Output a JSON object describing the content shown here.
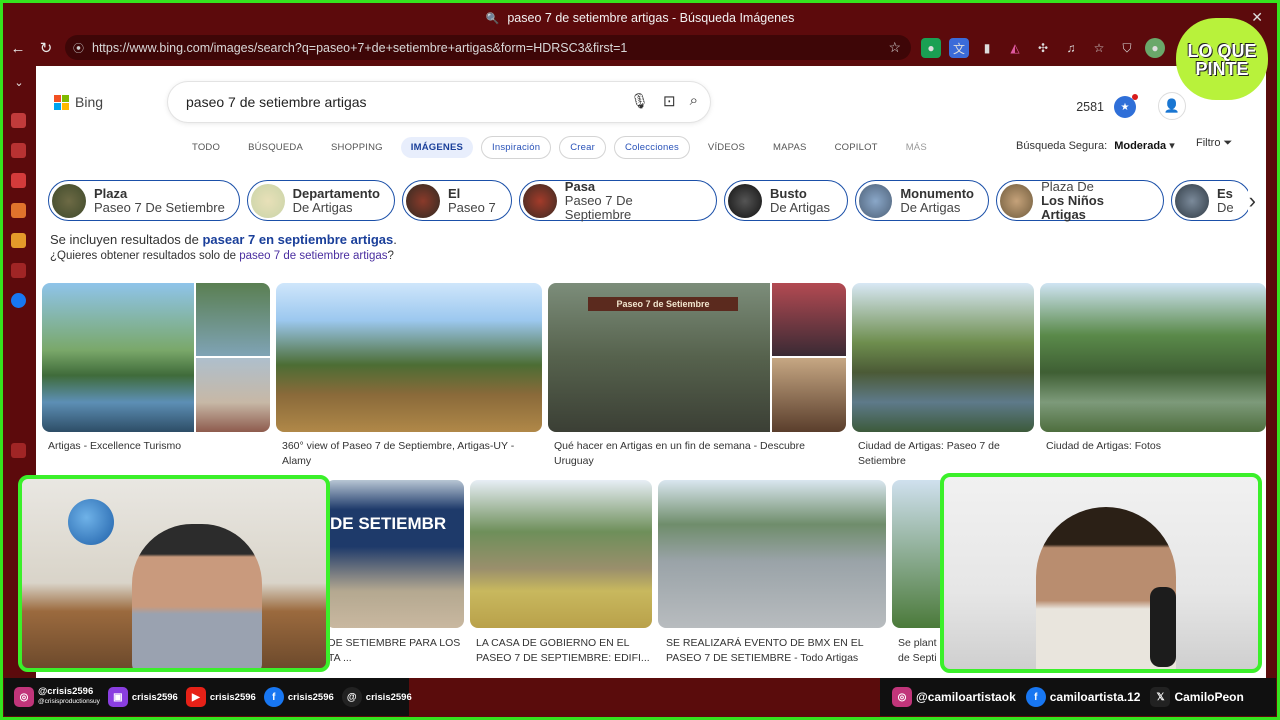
{
  "window": {
    "title": "paseo 7 de setiembre artigas - Búsqueda Imágenes"
  },
  "browser": {
    "url": "https://www.bing.com/images/search?q=paseo+7+de+setiembre+artigas&form=HDRSC3&first=1"
  },
  "bing": {
    "logo_text": "Bing",
    "query": "paseo 7 de setiembre artigas",
    "points": "2581",
    "tabs": [
      "TODO",
      "BÚSQUEDA",
      "SHOPPING",
      "IMÁGENES",
      "Inspiración",
      "Crear",
      "Colecciones",
      "VÍDEOS",
      "MAPAS",
      "COPILOT",
      "MÁS"
    ],
    "safe_label": "Búsqueda Segura:",
    "safe_value": "Moderada",
    "filter_label": "Filtro",
    "chips": [
      {
        "a": "Plaza",
        "b": "Paseo 7 De Setiembre",
        "bold_first": true
      },
      {
        "a": "Departamento",
        "b": "De Artigas",
        "bold_first": true
      },
      {
        "a": "El",
        "b": "Paseo 7",
        "bold_first": true
      },
      {
        "a": "Pasa",
        "b": "Paseo 7 De Septiembre",
        "bold_first": true
      },
      {
        "a": "Busto",
        "b": "De Artigas",
        "bold_first": true
      },
      {
        "a": "Monumento",
        "b": "De Artigas",
        "bold_first": true
      },
      {
        "a": "Plaza De",
        "b": "Los Niños Artigas",
        "bold_first": false
      },
      {
        "a": "Es",
        "b": "De",
        "bold_first": true
      }
    ],
    "notice_prefix": "Se incluyen resultados de ",
    "notice_link": "pasear 7 en septiembre artigas",
    "notice_suffix": ".",
    "notice2_prefix": "¿Quieres obtener resultados solo de ",
    "notice2_link": "paseo 7 de setiembre artigas",
    "notice2_suffix": "?",
    "results_row1": [
      "Artigas - Excellence Turismo",
      "360° view of Paseo 7 de Septiembre, Artigas-UY - Alamy",
      "Qué hacer en Artigas en un fin de semana - Descubre Uruguay",
      "Ciudad de Artigas: Paseo 7 de Setiembre",
      "Ciudad de Artigas: Fotos"
    ],
    "results_row2": [
      "DE SETIEMBRE PARA LOS\nTA ...",
      "LA CASA DE GOBIERNO EN EL\nPASEO 7 DE SEPTIEMBRE: EDIFI...",
      "SE REALIZARÁ EVENTO DE BMX EN EL\nPASEO 7 DE SETIEMBRE - Todo Artigas",
      "Se plant\nde Septi"
    ],
    "sign_texts": [
      "Paseo 7 de Setiembre",
      "DE SETIEMBR"
    ]
  },
  "overlay": {
    "left_socials": [
      {
        "icon": "instagram-icon",
        "text": "@crisis2596",
        "sub": "@crisisproductionsuy"
      },
      {
        "icon": "twitch-icon",
        "text": "crisis2596"
      },
      {
        "icon": "youtube-icon",
        "text": "crisis2596"
      },
      {
        "icon": "facebook-icon",
        "text": "crisis2596"
      },
      {
        "icon": "threads-icon",
        "text": "crisis2596"
      }
    ],
    "right_socials": [
      {
        "icon": "instagram-icon",
        "text": "@camiloartistaok"
      },
      {
        "icon": "facebook-icon",
        "text": "camiloartista.12"
      },
      {
        "icon": "x-icon",
        "text": "CamiloPeon"
      }
    ],
    "logo_text": "LO QUE PINTE"
  },
  "colors": {
    "frame": "#35e31f",
    "titlebar": "#5c0a0c",
    "accent": "#1a3f9a"
  }
}
